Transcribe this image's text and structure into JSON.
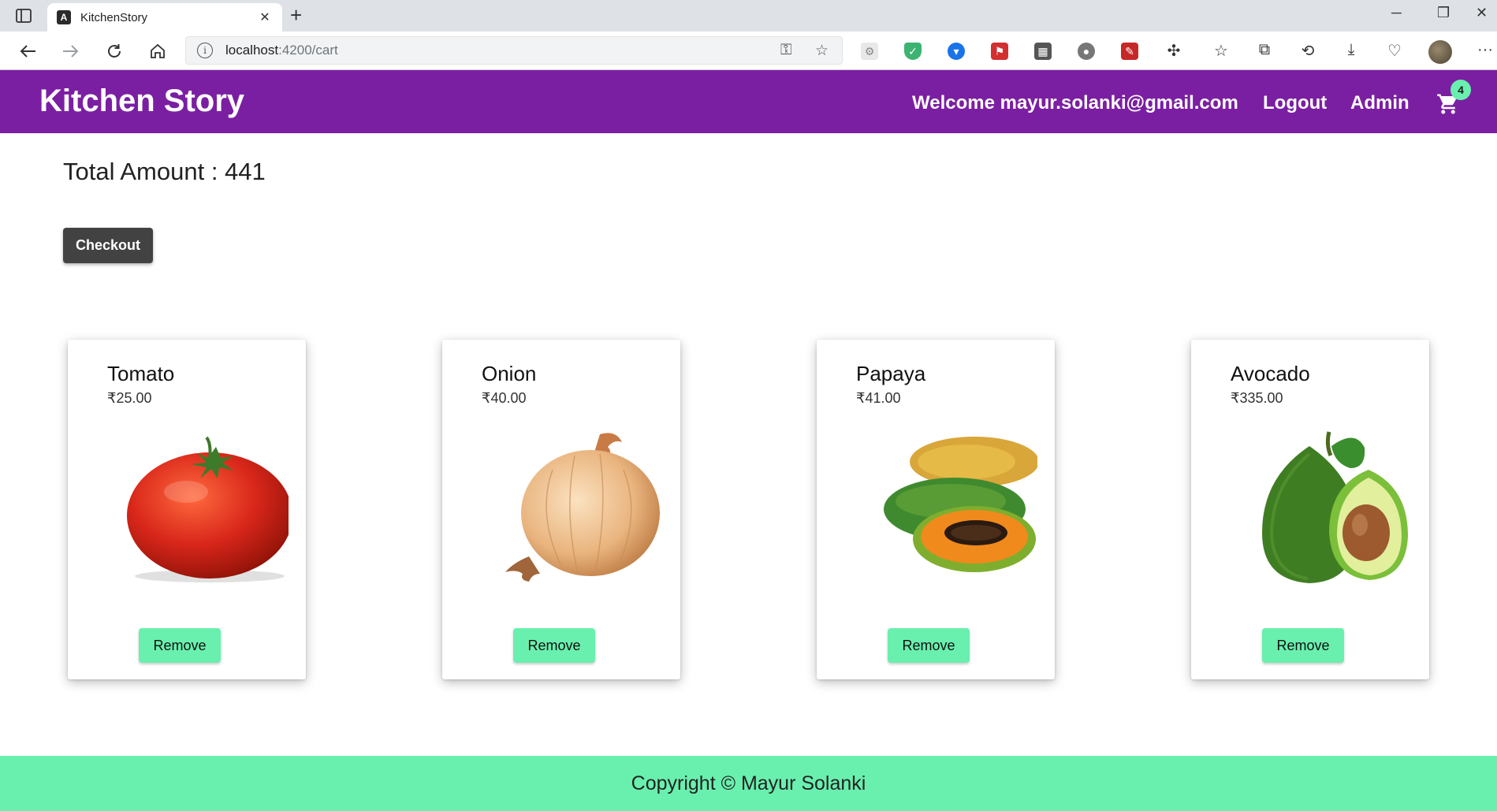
{
  "browser": {
    "tab_title": "KitchenStory",
    "tab_favicon": "A",
    "url_host": "localhost",
    "url_path": ":4200/cart",
    "icons": [
      "sidebar-icon",
      "close-icon",
      "new-tab-icon",
      "back-icon",
      "forward-icon",
      "reload-icon",
      "home-icon",
      "info-icon",
      "key-icon",
      "favorite-add-icon",
      "extensions-icon",
      "favorites-icon",
      "collections-icon",
      "history-icon",
      "download-icon",
      "performance-icon",
      "more-icon"
    ],
    "window_controls": {
      "minimize": "─",
      "restore": "❐",
      "close": "✕"
    },
    "more_label": "···"
  },
  "header": {
    "brand": "Kitchen Story",
    "welcome": "Welcome mayur.solanki@gmail.com",
    "logout": "Logout",
    "admin": "Admin",
    "cart_count": "4",
    "background": "#7b1fa2"
  },
  "cart": {
    "total_label": "Total Amount : 441",
    "checkout_label": "Checkout",
    "items": [
      {
        "name": "Tomato",
        "price": "₹25.00",
        "remove_label": "Remove"
      },
      {
        "name": "Onion",
        "price": "₹40.00",
        "remove_label": "Remove"
      },
      {
        "name": "Papaya",
        "price": "₹41.00",
        "remove_label": "Remove"
      },
      {
        "name": "Avocado",
        "price": "₹335.00",
        "remove_label": "Remove"
      }
    ]
  },
  "footer": {
    "text": "Copyright © Mayur Solanki",
    "background": "#69f0ae"
  }
}
